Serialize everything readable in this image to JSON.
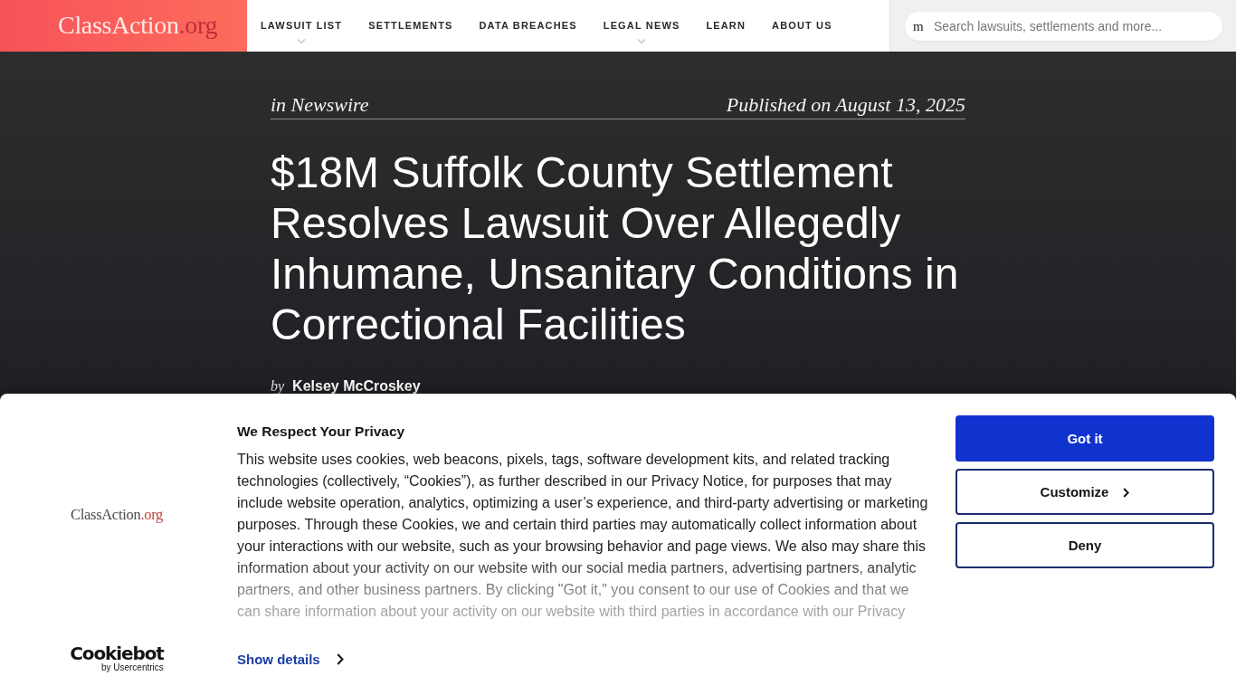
{
  "header": {
    "logo": {
      "name": "ClassAction",
      "suffix": ".org"
    },
    "nav": [
      {
        "label": "LAWSUIT LIST",
        "has_dropdown": true
      },
      {
        "label": "SETTLEMENTS",
        "has_dropdown": false
      },
      {
        "label": "DATA BREACHES",
        "has_dropdown": false
      },
      {
        "label": "LEGAL NEWS",
        "has_dropdown": true
      },
      {
        "label": "LEARN",
        "has_dropdown": false
      },
      {
        "label": "ABOUT US",
        "has_dropdown": false
      }
    ],
    "search": {
      "icon": "m",
      "placeholder": "Search lawsuits, settlements and more..."
    }
  },
  "article": {
    "category": "in Newswire",
    "published": "Published on August 13, 2025",
    "title": "$18M Suffolk County Settlement Resolves Lawsuit Over Allegedly Inhumane, Unsanitary Conditions in Correctional Facilities",
    "byline": {
      "prefix": "by",
      "author": "Kelsey McCroskey"
    }
  },
  "cookie_banner": {
    "logo": {
      "name": "ClassAction",
      "suffix": ".org"
    },
    "title": "We Respect Your Privacy",
    "text": "This website uses cookies, web beacons, pixels, tags, software development kits, and related tracking technologies (collectively, “Cookies”), as further described in our Privacy Notice, for purposes that may include website operation, analytics, optimizing a user’s experience, and third-party advertising or marketing purposes. Through these Cookies, we and certain third parties may automatically collect information about your interactions with our website, such as your browsing behavior and page views. We also may share this information about your activity on our website with our social media partners, advertising partners, analytic partners, and other business partners. By clicking \"Got it,\" you consent to our use of Cookies and that we can share information about your activity on our website with third parties in accordance with our Privacy",
    "buttons": [
      {
        "label": "Got it",
        "kind": "primary",
        "chevron": false
      },
      {
        "label": "Customize",
        "kind": "outline",
        "chevron": true
      },
      {
        "label": "Deny",
        "kind": "outline",
        "chevron": false
      }
    ],
    "details_link": "Show details",
    "branding": {
      "name": "Cookiebot",
      "tagline": "by Usercentrics"
    }
  }
}
